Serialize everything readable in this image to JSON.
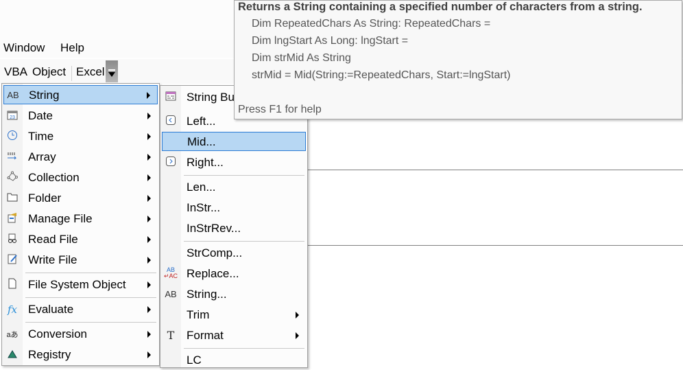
{
  "menubar": {
    "items": [
      {
        "label": "Window",
        "u": "W"
      },
      {
        "label": "Help",
        "u": "H"
      }
    ]
  },
  "toolbar": {
    "items": [
      "VBA",
      "Object",
      "Excel"
    ],
    "overflow_icon": "chevron-overflow-icon"
  },
  "main_menu": {
    "items": [
      {
        "label": "String",
        "icon": "ab-text-icon",
        "submenu": true,
        "selected": true
      },
      {
        "label": "Date",
        "icon": "calendar-icon",
        "submenu": true
      },
      {
        "label": "Time",
        "icon": "clock-icon",
        "submenu": true
      },
      {
        "label": "Array",
        "icon": "array-icon",
        "submenu": true
      },
      {
        "label": "Collection",
        "icon": "collection-icon",
        "submenu": true
      },
      {
        "label": "Folder",
        "icon": "folder-icon",
        "submenu": true
      },
      {
        "label": "Manage File",
        "icon": "manage-file-icon",
        "submenu": true
      },
      {
        "label": "Read File",
        "icon": "read-file-icon",
        "submenu": true
      },
      {
        "label": "Write File",
        "icon": "write-file-icon",
        "submenu": true
      },
      {
        "label": "File System Object",
        "icon": "file-icon",
        "submenu": true
      },
      {
        "label": "Evaluate",
        "icon": "fx-icon",
        "submenu": true
      },
      {
        "label": "Conversion",
        "icon": "conversion-icon",
        "submenu": true
      },
      {
        "label": "Registry",
        "icon": "registry-icon",
        "submenu": true
      }
    ]
  },
  "string_menu": {
    "items": [
      {
        "label": "String Bu",
        "icon": "string-builder-icon"
      },
      {
        "label": "Left...",
        "icon": "chevron-left-icon"
      },
      {
        "label": "Mid...",
        "selected": true
      },
      {
        "label": "Right...",
        "icon": "chevron-right-icon"
      },
      {
        "label": "Len..."
      },
      {
        "label": "InStr..."
      },
      {
        "label": "InStrRev..."
      },
      {
        "label": "StrComp..."
      },
      {
        "label": "Replace...",
        "icon": "replace-icon"
      },
      {
        "label": "String...",
        "icon": "ab-text-icon"
      },
      {
        "label": "Trim",
        "submenu": true
      },
      {
        "label": "Format",
        "icon": "format-icon",
        "submenu": true
      },
      {
        "label": "LC"
      }
    ]
  },
  "tooltip": {
    "title": "Returns a  String containing a specified number of characters from a string.",
    "code": [
      "Dim RepeatedChars As String: RepeatedChars =",
      "Dim lngStart As Long: lngStart =",
      "Dim strMid As String",
      "strMid = Mid(String:=RepeatedChars, Start:=lngStart)"
    ],
    "help": "Press F1 for help"
  },
  "colors": {
    "selection": "#b7d7f3",
    "selection_border": "#2b7bd4"
  }
}
